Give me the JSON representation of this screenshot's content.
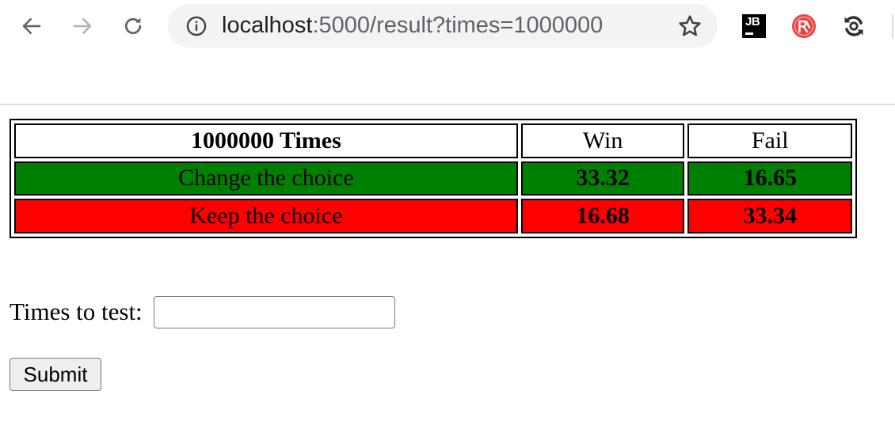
{
  "browser": {
    "url_host": "localhost",
    "url_rest": ":5000/result?times=1000000",
    "extensions": {
      "jb_label": "JB"
    },
    "icons": [
      "back-arrow-icon",
      "forward-arrow-icon",
      "reload-icon",
      "info-icon",
      "star-icon",
      "jetbrains-extension-icon",
      "red-extension-icon",
      "sync-extension-icon"
    ]
  },
  "table": {
    "header": {
      "label": "1000000 Times",
      "win": "Win",
      "fail": "Fail"
    },
    "rows": [
      {
        "label": "Change the choice",
        "win": "33.32",
        "fail": "16.65",
        "color": "#008000"
      },
      {
        "label": "Keep the choice",
        "win": "16.68",
        "fail": "33.34",
        "color": "#ff0000"
      }
    ]
  },
  "form": {
    "times_label": "Times to test:",
    "times_value": "",
    "submit_label": "Submit"
  }
}
